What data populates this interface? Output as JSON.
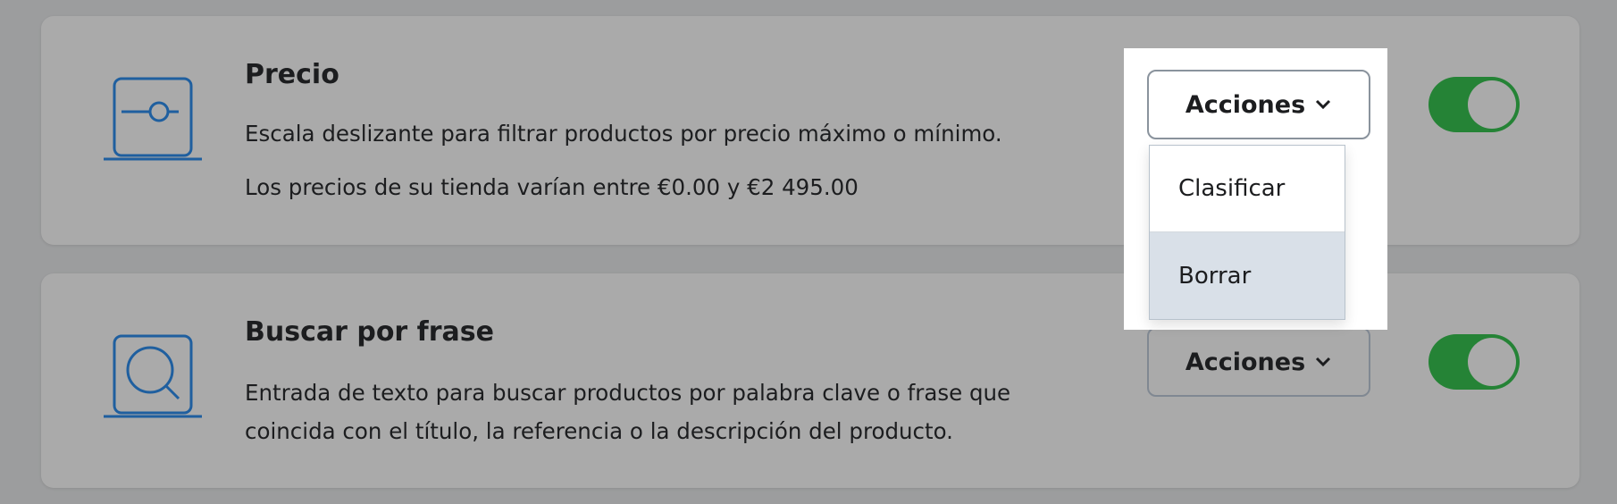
{
  "colors": {
    "icon_blue": "#1f5f9f",
    "toggle_green": "#258336",
    "card_bg": "#aaaaaa",
    "menu_highlight": "#d9e0e8"
  },
  "filters": [
    {
      "icon": "slider-icon",
      "title": "Precio",
      "description_lines": [
        "Escala deslizante para filtrar productos por precio máximo o mínimo.",
        "Los precios de su tienda varían entre €0.00 y €2 495.00"
      ],
      "actions_label": "Acciones",
      "enabled": true
    },
    {
      "icon": "search-icon",
      "title": "Buscar por frase",
      "description_lines": [
        "Entrada de texto para buscar productos por palabra clave o frase que",
        "coincida con el título, la referencia o la descripción del producto."
      ],
      "actions_label": "Acciones",
      "enabled": true
    }
  ],
  "dropdown": {
    "items": [
      {
        "label": "Clasificar",
        "active": false
      },
      {
        "label": "Borrar",
        "active": true
      }
    ]
  }
}
